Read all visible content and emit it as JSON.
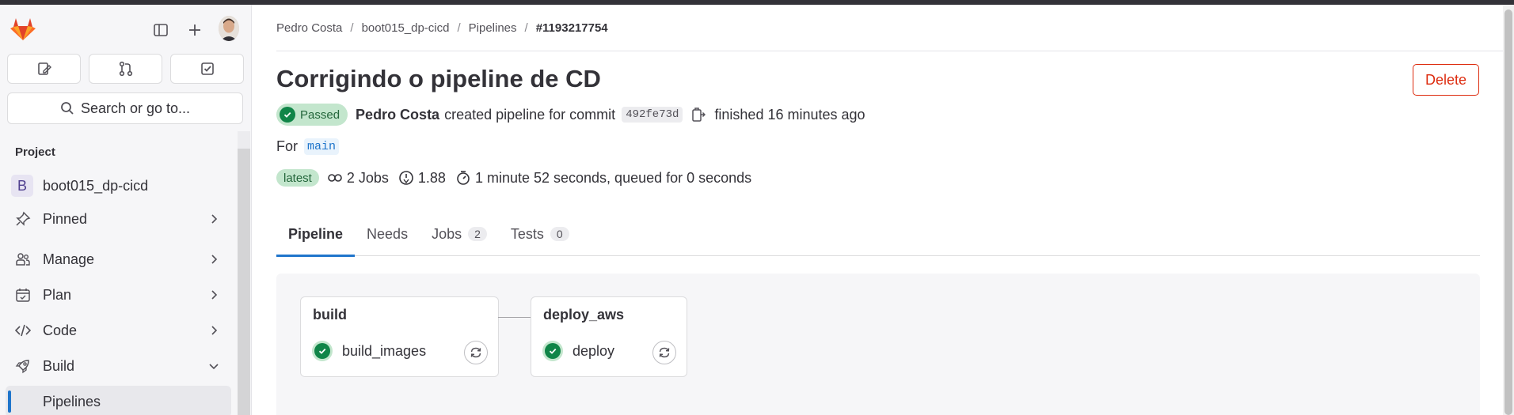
{
  "sidebar": {
    "search_label": "Search or go to...",
    "section_label": "Project",
    "project": {
      "initial": "B",
      "name": "boot015_dp-cicd"
    },
    "items": [
      {
        "label": "Pinned",
        "icon": "pin-icon"
      },
      {
        "label": "Manage",
        "icon": "users-icon"
      },
      {
        "label": "Plan",
        "icon": "calendar-icon"
      },
      {
        "label": "Code",
        "icon": "code-icon"
      },
      {
        "label": "Build",
        "icon": "rocket-icon"
      }
    ],
    "active_item": "Pipelines"
  },
  "breadcrumb": [
    "Pedro Costa",
    "boot015_dp-cicd",
    "Pipelines",
    "#1193217754"
  ],
  "pipeline": {
    "title": "Corrigindo o pipeline de CD",
    "delete_label": "Delete",
    "status": "Passed",
    "author": "Pedro Costa",
    "created_text": "created pipeline for commit",
    "commit_sha": "492fe73d",
    "finished_text": "finished 16 minutes ago",
    "for_label": "For",
    "branch": "main",
    "latest_label": "latest",
    "jobs_text": "2 Jobs",
    "compute_text": "1.88",
    "duration_text": "1 minute 52 seconds, queued for 0 seconds"
  },
  "tabs": [
    {
      "label": "Pipeline",
      "count": null
    },
    {
      "label": "Needs",
      "count": null
    },
    {
      "label": "Jobs",
      "count": "2"
    },
    {
      "label": "Tests",
      "count": "0"
    }
  ],
  "stages": [
    {
      "name": "build",
      "job": "build_images",
      "status": "success"
    },
    {
      "name": "deploy_aws",
      "job": "deploy",
      "status": "success"
    }
  ],
  "colors": {
    "accent": "#1f75cb",
    "success": "#108548",
    "danger": "#dd2b0e"
  }
}
